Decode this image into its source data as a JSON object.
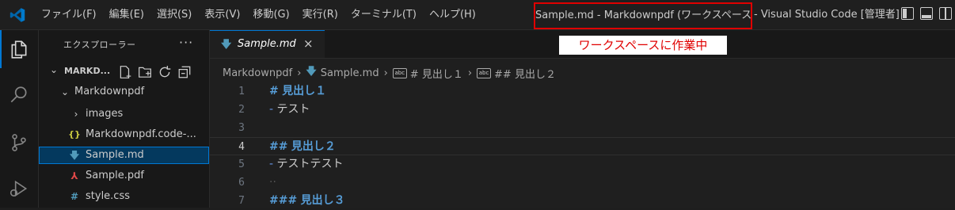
{
  "menu": [
    "ファイル(F)",
    "編集(E)",
    "選択(S)",
    "表示(V)",
    "移動(G)",
    "実行(R)",
    "ターミナル(T)",
    "ヘルプ(H)"
  ],
  "window_title": "Sample.md - Markdownpdf (ワークスペース)",
  "window_title_rest": "- Visual Studio Code [管理者]",
  "annotation": "ワークスペースに作業中",
  "sidebar": {
    "title": "エクスプローラー",
    "more": "···",
    "section_label": "MARKD...",
    "items": [
      {
        "label": "Markdownpdf",
        "chevron": "⌄",
        "icon": ""
      },
      {
        "label": "images",
        "chevron": "›",
        "icon": ""
      },
      {
        "label": "Markdownpdf.code-...",
        "chevron": "",
        "icon": "{}"
      },
      {
        "label": "Sample.md",
        "chevron": "",
        "icon": "🡇"
      },
      {
        "label": "Sample.pdf",
        "chevron": "",
        "icon": "⅄"
      },
      {
        "label": "style.css",
        "chevron": "",
        "icon": "#"
      }
    ]
  },
  "tab": {
    "label": "Sample.md",
    "close": "×"
  },
  "breadcrumb": {
    "root": "Markdownpdf",
    "file": "Sample.md",
    "h1": "# 見出し１",
    "h2": "## 見出し２",
    "sym_icon": "abc",
    "sep": "›"
  },
  "lines": [
    {
      "n": "1",
      "hash": "#",
      "text": "見出し１",
      "kind": "heading"
    },
    {
      "n": "2",
      "hash": "-",
      "text": "テスト",
      "kind": "list"
    },
    {
      "n": "3",
      "hash": "",
      "text": "",
      "kind": "blank"
    },
    {
      "n": "4",
      "hash": "##",
      "text": "見出し２",
      "kind": "heading"
    },
    {
      "n": "5",
      "hash": "-",
      "text": "テストテスト",
      "kind": "list"
    },
    {
      "n": "6",
      "hash": "··",
      "text": "",
      "kind": "ws"
    },
    {
      "n": "7",
      "hash": "###",
      "text": "見出し３",
      "kind": "heading"
    }
  ],
  "colors": {
    "accent": "#0078d4",
    "highlight_border": "#e00000",
    "heading": "#569cd6"
  }
}
